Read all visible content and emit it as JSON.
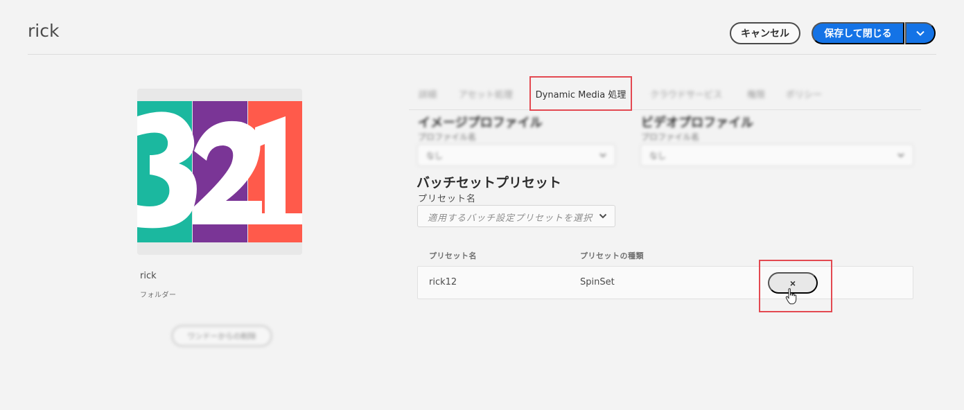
{
  "header": {
    "title": "rick",
    "cancel_label": "キャンセル",
    "save_label": "保存して閉じる"
  },
  "asset": {
    "name": "rick",
    "type": "フォルダー",
    "thumbnail_text": "321",
    "thumbnail_colors": [
      "#1bb89f",
      "#7a3596",
      "#ff5a4b"
    ],
    "blurred_button_label": "ワンドーからの削除"
  },
  "tabs": [
    {
      "label": "詳細",
      "active": false
    },
    {
      "label": "アセット処理",
      "active": false
    },
    {
      "label": "Dynamic Media 処理",
      "active": true
    },
    {
      "label": "クラウドサービス",
      "active": false
    },
    {
      "label": "権限",
      "active": false
    },
    {
      "label": "ポリシー",
      "active": false
    }
  ],
  "image_profile": {
    "heading": "イメージプロファイル",
    "field_label": "プロファイル名",
    "value": "なし"
  },
  "video_profile": {
    "heading": "ビデオプロファイル",
    "field_label": "プロファイル名",
    "value": "なし"
  },
  "batch_set": {
    "heading": "バッチセットプリセット",
    "field_label": "プリセット名",
    "placeholder": "適用するバッチ設定プリセットを選択",
    "columns": [
      "プリセット名",
      "プリセットの種類"
    ],
    "rows": [
      {
        "name": "rick12",
        "type": "SpinSet",
        "remove_label": "×"
      }
    ]
  },
  "colors": {
    "accent": "#1473e6",
    "highlight": "#e34850"
  }
}
